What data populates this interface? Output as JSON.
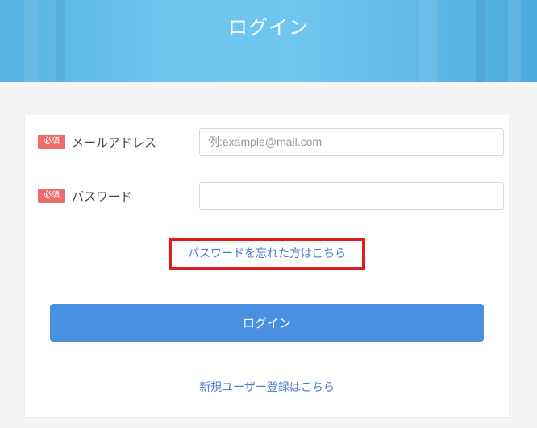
{
  "header": {
    "title": "ログイン"
  },
  "form": {
    "email": {
      "badge": "必須",
      "label": "メールアドレス",
      "placeholder": "例:example@mail.com",
      "value": ""
    },
    "password": {
      "badge": "必須",
      "label": "パスワード",
      "placeholder": "",
      "value": ""
    },
    "forgot_link": "パスワードを忘れた方はこちら",
    "login_button": "ログイン",
    "register_link": "新規ユーザー登録はこちら"
  },
  "colors": {
    "header_blue": "#6cc4ef",
    "required_badge": "#ec6b6b",
    "primary_button": "#4a90e2",
    "link": "#4a7fd1",
    "highlight_border": "#e11b1b"
  }
}
